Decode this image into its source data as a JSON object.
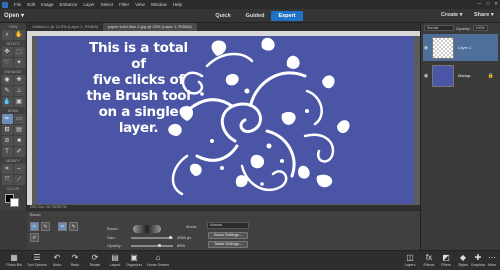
{
  "menu": {
    "items": [
      "File",
      "Edit",
      "Image",
      "Enhance",
      "Layer",
      "Select",
      "Filter",
      "View",
      "Window",
      "Help"
    ],
    "controls": [
      "—",
      "□",
      "✕"
    ]
  },
  "modebar": {
    "open": "Open",
    "modes": [
      "Quick",
      "Guided",
      "Expert"
    ],
    "create": "Create",
    "share": "Share"
  },
  "tools": {
    "sections": [
      "VIEW",
      "SELECT",
      "ENHANCE",
      "DRAW",
      "MODIFY",
      "COLOR"
    ]
  },
  "tabs": [
    "Untitled-1 @ 12.5% (Layer 1, RGB/8)",
    "paper solid blue 2.jpg @ 25% (Layer 1, RGB/8)"
  ],
  "canvas": {
    "caption": [
      "This is a total of",
      "five clicks of",
      "the Brush tool",
      "on a single",
      "layer."
    ]
  },
  "status": "25%   Doc: 28.7M/28.7M",
  "layers": {
    "blend_mode": "Normal",
    "opacity_label": "Opacity:",
    "opacity_value": "100%",
    "items": [
      {
        "name": "Layer 1"
      },
      {
        "name": "Backgr..."
      }
    ]
  },
  "tool_options": {
    "title": "Brush",
    "brush_label": "Brush:",
    "size_label": "Size:",
    "size_value": "2000 px",
    "opacity_label": "Opacity:",
    "opacity_value": "69%",
    "opacity_level": 0.69,
    "mode_label": "Mode:",
    "mode_value": "Normal",
    "brush_settings": "Brush Settings...",
    "tablet_settings": "Tablet Settings..."
  },
  "bottom_left": [
    {
      "label": "Photo Bin",
      "icon": "photo-bin-icon"
    },
    {
      "label": "Tool Options",
      "icon": "tool-options-icon"
    },
    {
      "label": "Undo",
      "icon": "undo-icon"
    },
    {
      "label": "Redo",
      "icon": "redo-icon"
    },
    {
      "label": "Rotate",
      "icon": "rotate-icon"
    },
    {
      "label": "Layout",
      "icon": "layout-icon"
    },
    {
      "label": "Organizer",
      "icon": "organizer-icon"
    },
    {
      "label": "Home Screen",
      "icon": "home-icon"
    }
  ],
  "bottom_right": [
    {
      "label": "Layers",
      "icon": "layers-icon"
    },
    {
      "label": "Effects",
      "icon": "effects-icon"
    },
    {
      "label": "Filters",
      "icon": "filters-icon"
    },
    {
      "label": "Styles",
      "icon": "styles-icon"
    },
    {
      "label": "Graphics",
      "icon": "graphics-icon"
    },
    {
      "label": "More",
      "icon": "more-icon"
    }
  ]
}
